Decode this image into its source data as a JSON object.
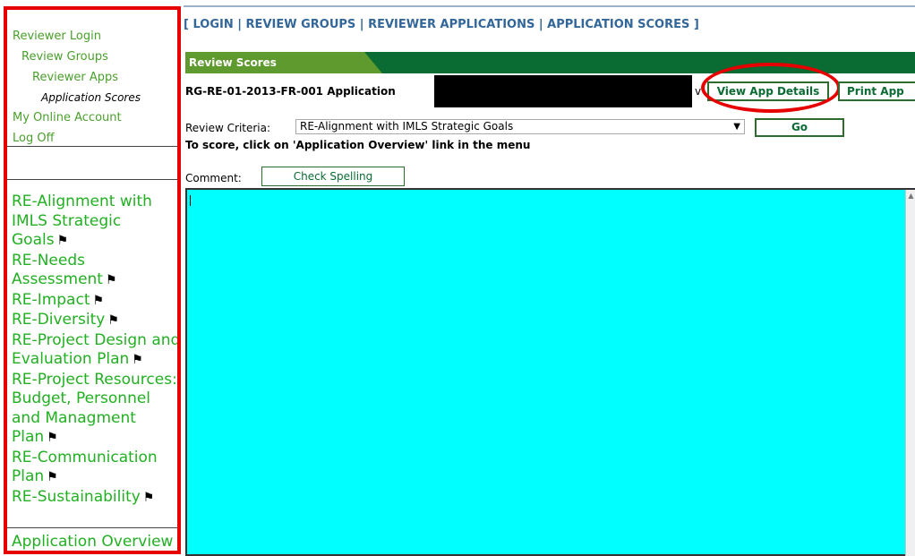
{
  "sidebar": {
    "nav": [
      {
        "label": "Reviewer Login"
      },
      {
        "label": "Review Groups"
      },
      {
        "label": "Reviewer Apps"
      },
      {
        "label": "Application Scores"
      },
      {
        "label": "My Online Account"
      },
      {
        "label": "Log Off"
      }
    ],
    "criteria": [
      "RE-Alignment with IMLS Strategic Goals",
      "RE-Needs Assessment",
      "RE-Impact",
      "RE-Diversity",
      "RE-Project Design and Evaluation Plan",
      "RE-Project Resources: Budget, Personnel and Managment Plan",
      "RE-Communication Plan",
      "RE-Sustainability"
    ],
    "flag_icon": "flag-icon",
    "app_overview": "Application Overview"
  },
  "topnav": {
    "open": "[ ",
    "sep": " | ",
    "close": " ]",
    "login": "LOGIN",
    "review_groups": "REVIEW GROUPS",
    "reviewer_applications": "REVIEWER APPLICATIONS",
    "application_scores": "APPLICATION SCORES"
  },
  "tab": {
    "label": "Review Scores"
  },
  "application": {
    "id_label": "RG-RE-01-2013-FR-001  Application",
    "trailing_char": "v",
    "view_details": "View App Details",
    "print": "Print App"
  },
  "form": {
    "criteria_label": "Review Criteria:",
    "criteria_value": "RE-Alignment with IMLS Strategic Goals",
    "go": "Go",
    "hint": "To score, click on 'Application Overview' link in the menu",
    "comment_label": "Comment:",
    "spell": "Check Spelling"
  },
  "colors": {
    "highlight_red": "#e60000",
    "nav_green": "#4aa02c",
    "criteria_green": "#22b022",
    "tab_bar": "#0a6b33",
    "editor_bg": "#00ffff"
  }
}
